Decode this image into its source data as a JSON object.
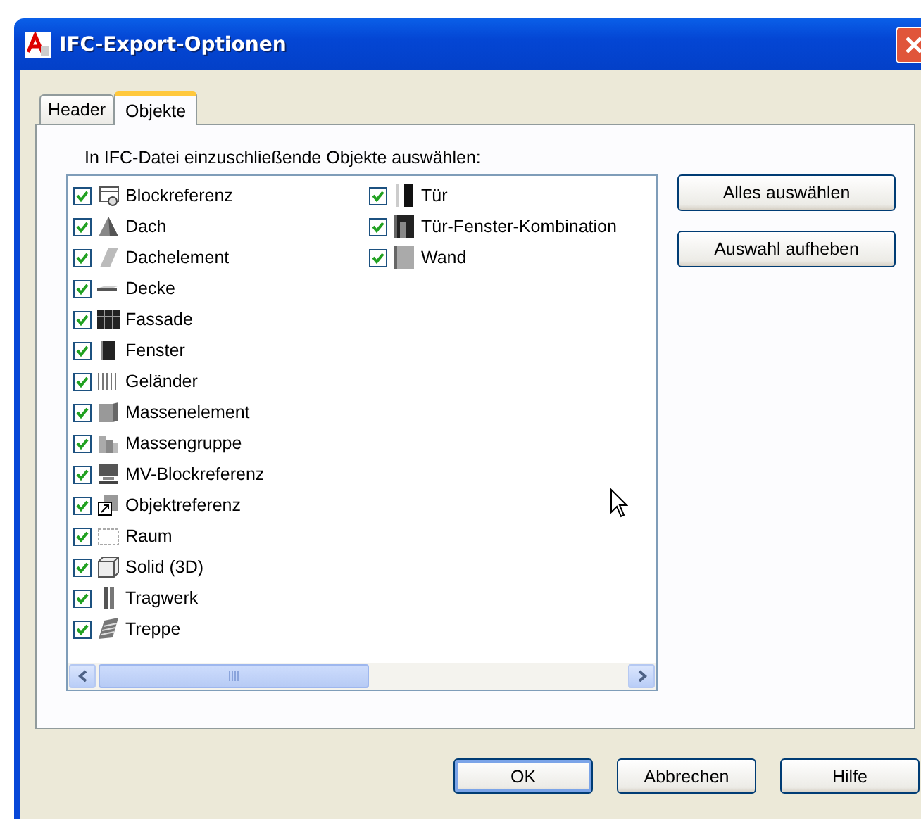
{
  "window": {
    "title": "IFC-Export-Optionen"
  },
  "tabs": [
    {
      "label": "Header",
      "selected": false
    },
    {
      "label": "Objekte",
      "selected": true
    }
  ],
  "prompt": "In IFC-Datei einzuschließende Objekte auswählen:",
  "items": [
    {
      "label": "Blockreferenz",
      "checked": true
    },
    {
      "label": "Dach",
      "checked": true
    },
    {
      "label": "Dachelement",
      "checked": true
    },
    {
      "label": "Decke",
      "checked": true
    },
    {
      "label": "Fassade",
      "checked": true
    },
    {
      "label": "Fenster",
      "checked": true
    },
    {
      "label": "Geländer",
      "checked": true
    },
    {
      "label": "Massenelement",
      "checked": true
    },
    {
      "label": "Massengruppe",
      "checked": true
    },
    {
      "label": "MV-Blockreferenz",
      "checked": true
    },
    {
      "label": "Objektreferenz",
      "checked": true
    },
    {
      "label": "Raum",
      "checked": true
    },
    {
      "label": "Solid (3D)",
      "checked": true
    },
    {
      "label": "Tragwerk",
      "checked": true
    },
    {
      "label": "Treppe",
      "checked": true
    },
    {
      "label": "Tür",
      "checked": true
    },
    {
      "label": "Tür-Fenster-Kombination",
      "checked": true
    },
    {
      "label": "Wand",
      "checked": true
    }
  ],
  "side_buttons": [
    "Alles auswählen",
    "Auswahl aufheben"
  ],
  "buttons": [
    "OK",
    "Abbrechen",
    "Hilfe"
  ]
}
